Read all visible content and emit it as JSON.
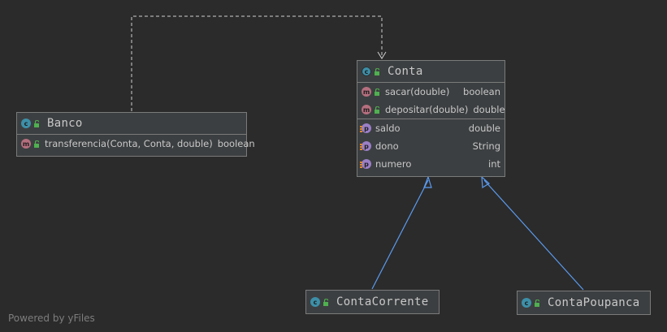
{
  "colors": {
    "background": "#2b2b2b",
    "node_fill": "#3c3f41",
    "node_border": "#7a7a7a",
    "inheritance_edge": "#5b9bf0",
    "dependency_edge": "#cfcfcf",
    "class_badge": "#3d8fa8",
    "method_badge": "#b56f7f",
    "property_badge": "#9a7fc7",
    "visibility_public": "#4fb04f"
  },
  "classes": {
    "banco": {
      "name": "Banco",
      "methods": [
        {
          "name": "transferencia(Conta, Conta, double)",
          "type": "boolean"
        }
      ]
    },
    "conta": {
      "name": "Conta",
      "methods": [
        {
          "name": "sacar(double)",
          "type": "boolean"
        },
        {
          "name": "depositar(double)",
          "type": "double"
        }
      ],
      "properties": [
        {
          "name": "saldo",
          "type": "double"
        },
        {
          "name": "dono",
          "type": "String"
        },
        {
          "name": "numero",
          "type": "int"
        }
      ]
    },
    "conta_corrente": {
      "name": "ContaCorrente"
    },
    "conta_poupanca": {
      "name": "ContaPoupanca"
    }
  },
  "badges": {
    "class": "c",
    "method": "m",
    "property": "p"
  },
  "edges": [
    {
      "from": "Banco",
      "to": "Conta",
      "kind": "dependency",
      "style": "dashed"
    },
    {
      "from": "ContaCorrente",
      "to": "Conta",
      "kind": "inheritance",
      "style": "solid"
    },
    {
      "from": "ContaPoupanca",
      "to": "Conta",
      "kind": "inheritance",
      "style": "solid"
    }
  ],
  "watermark": "Powered by yFiles"
}
